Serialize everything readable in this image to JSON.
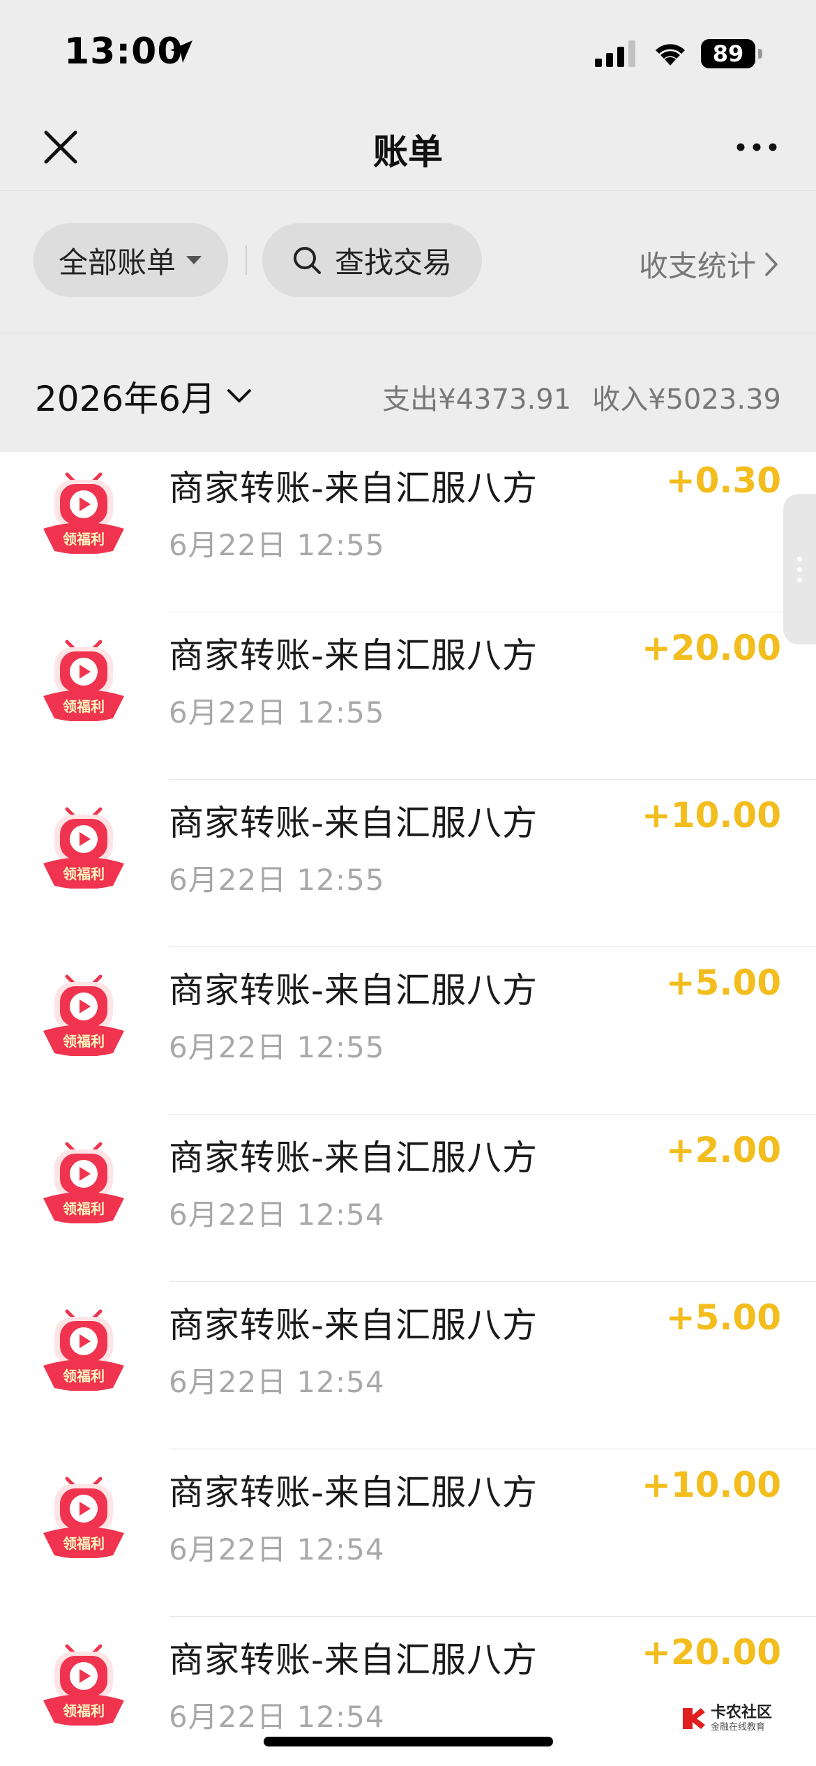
{
  "status_bar": {
    "time": "13:00",
    "battery": "89"
  },
  "nav": {
    "title": "账单"
  },
  "filters": {
    "all_bills": "全部账单",
    "search": "查找交易",
    "stats": "收支统计"
  },
  "month": {
    "label": "2026年6月",
    "expense": "支出¥4373.91",
    "income": "收入¥5023.39"
  },
  "transactions": [
    {
      "merchant": "商家转账-来自汇服八方",
      "time": "6月22日 12:55",
      "amount": "+0.30"
    },
    {
      "merchant": "商家转账-来自汇服八方",
      "time": "6月22日 12:55",
      "amount": "+20.00"
    },
    {
      "merchant": "商家转账-来自汇服八方",
      "time": "6月22日 12:55",
      "amount": "+10.00"
    },
    {
      "merchant": "商家转账-来自汇服八方",
      "time": "6月22日 12:55",
      "amount": "+5.00"
    },
    {
      "merchant": "商家转账-来自汇服八方",
      "time": "6月22日 12:54",
      "amount": "+2.00"
    },
    {
      "merchant": "商家转账-来自汇服八方",
      "time": "6月22日 12:54",
      "amount": "+5.00"
    },
    {
      "merchant": "商家转账-来自汇服八方",
      "time": "6月22日 12:54",
      "amount": "+10.00"
    },
    {
      "merchant": "商家转账-来自汇服八方",
      "time": "6月22日 12:54",
      "amount": "+20.00"
    }
  ],
  "merchant_logo": {
    "badge": "领福利",
    "icon": "play-icon"
  },
  "watermark": {
    "main": "卡农社区",
    "sub": "金融在线教育"
  },
  "colors": {
    "amount": "#f2bd1d",
    "background": "#ededed",
    "logo_red": "#f0344f"
  }
}
